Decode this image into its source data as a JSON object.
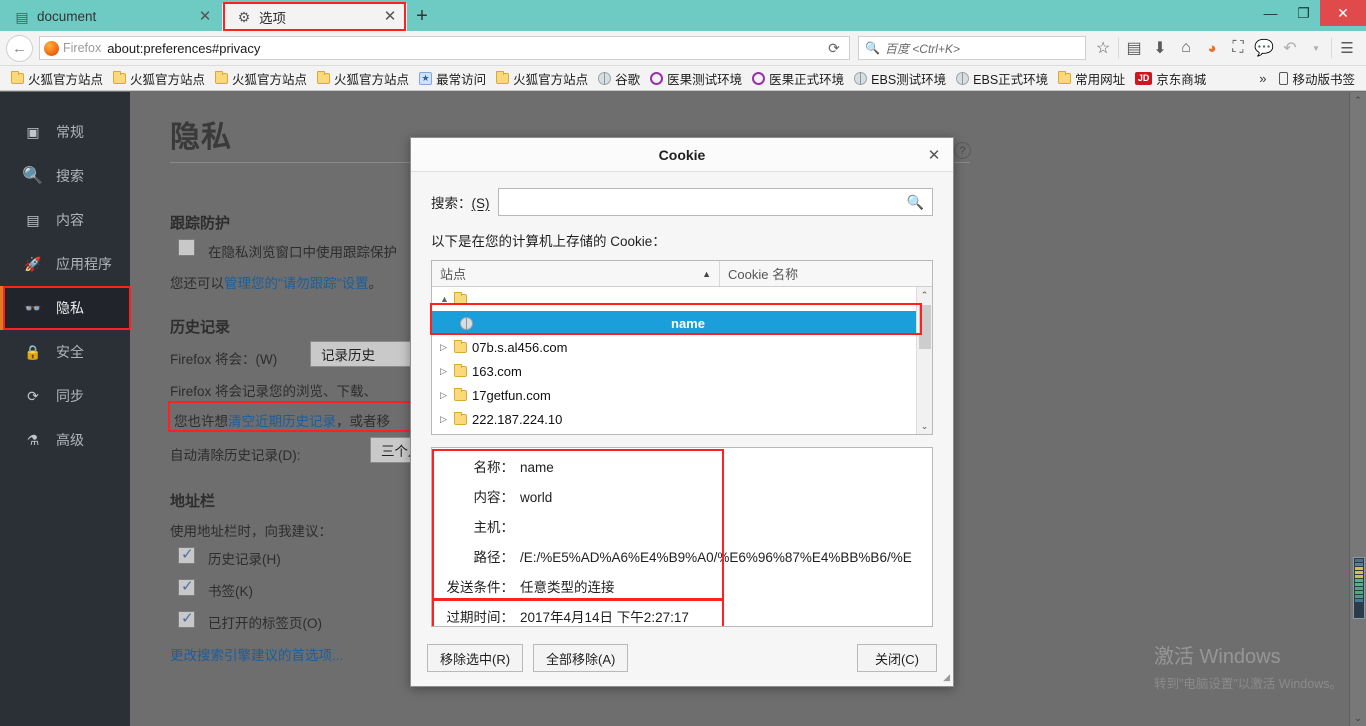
{
  "window": {
    "minimize_label": "—",
    "maximize_label": "❐",
    "close_label": "✕"
  },
  "tabs": [
    {
      "title": "document",
      "icon": "page-icon",
      "active": false,
      "close_label": "✕"
    },
    {
      "title": "选项",
      "icon": "gear-icon",
      "active": true,
      "close_label": "✕",
      "highlighted": true
    }
  ],
  "newtab_label": "+",
  "navbar": {
    "back_label": "←",
    "firefox_badge": "Firefox",
    "url": "about:preferences#privacy",
    "reload_label": "⟳",
    "search_placeholder": "百度 <Ctrl+K>",
    "search_value": "",
    "icons": [
      "star-icon",
      "reader-icon",
      "download-icon",
      "home-icon",
      "pocket-icon",
      "screenshot-icon",
      "chat-icon",
      "undo-icon",
      "chevron-down-icon",
      "hamburger-menu-icon"
    ]
  },
  "bookmarks": [
    {
      "label": "火狐官方站点",
      "icon": "folder-icon"
    },
    {
      "label": "火狐官方站点",
      "icon": "folder-icon"
    },
    {
      "label": "火狐官方站点",
      "icon": "folder-icon"
    },
    {
      "label": "火狐官方站点",
      "icon": "folder-icon"
    },
    {
      "label": "最常访问",
      "icon": "bluebox-icon"
    },
    {
      "label": "火狐官方站点",
      "icon": "folder-icon"
    },
    {
      "label": "谷歌",
      "icon": "globe-icon"
    },
    {
      "label": "医果测试环境",
      "icon": "ring-icon"
    },
    {
      "label": "医果正式环境",
      "icon": "ring-icon"
    },
    {
      "label": "EBS测试环境",
      "icon": "globe-icon"
    },
    {
      "label": "EBS正式环境",
      "icon": "globe-icon"
    },
    {
      "label": "常用网址",
      "icon": "folder-icon"
    },
    {
      "label": "京东商城",
      "icon": "jd-icon"
    }
  ],
  "bookmarks_overflow_label": "»",
  "bookmarks_mobile": {
    "label": "移动版书签",
    "icon": "phone-icon"
  },
  "sidebar": {
    "items": [
      {
        "label": "常规",
        "icon": "general-icon",
        "selected": false
      },
      {
        "label": "搜索",
        "icon": "search-icon",
        "selected": false
      },
      {
        "label": "内容",
        "icon": "content-icon",
        "selected": false
      },
      {
        "label": "应用程序",
        "icon": "applications-icon",
        "selected": false
      },
      {
        "label": "隐私",
        "icon": "mask-icon",
        "selected": true
      },
      {
        "label": "安全",
        "icon": "lock-icon",
        "selected": false
      },
      {
        "label": "同步",
        "icon": "sync-icon",
        "selected": false
      },
      {
        "label": "高级",
        "icon": "advanced-icon",
        "selected": false
      }
    ]
  },
  "preferences": {
    "title": "隐私",
    "help_label": "?",
    "tracking": {
      "heading": "跟踪防护",
      "checkbox_label": "在隐私浏览窗口中使用跟踪保护",
      "checkbox_checked": false,
      "note_prefix": "您还可以",
      "note_link": "管理您的\"请勿跟踪\"设置",
      "note_suffix": "。"
    },
    "history": {
      "heading": "历史记录",
      "will_label": "Firefox 将会：(W)",
      "will_value": "记录历史",
      "desc": "Firefox 将会记录您的浏览、下载、",
      "clear_prefix": "您也许想",
      "clear_link": "清空近期历史记录",
      "clear_suffix": "，或者移",
      "auto_label": "自动清除历史记录(D):",
      "auto_value": "三个月以前"
    },
    "addressbar": {
      "heading": "地址栏",
      "desc": "使用地址栏时，向我建议：",
      "options": [
        {
          "label": "历史记录(H)",
          "checked": true
        },
        {
          "label": "书签(K)",
          "checked": true
        },
        {
          "label": "已打开的标签页(O)",
          "checked": true
        }
      ],
      "change_link": "更改搜索引擎建议的首选项..."
    }
  },
  "dialog": {
    "title": "Cookie",
    "close_label": "✕",
    "search_label": "搜索：(S)",
    "search_value": "",
    "search_icon": "search-icon",
    "description": "以下是在您的计算机上存储的 Cookie：",
    "columns": {
      "site": "站点",
      "cookie_name": "Cookie 名称",
      "sort_arrow": "▲"
    },
    "rows": [
      {
        "label": "",
        "icon": "folder-icon",
        "twisty": "▲",
        "level": 0,
        "selected": false
      },
      {
        "label": "",
        "cookie_name": "name",
        "icon": "globe-icon",
        "level": 1,
        "selected": true
      },
      {
        "label": "07b.s.al456.com",
        "icon": "folder-icon",
        "twisty": "▷",
        "level": 0,
        "selected": false
      },
      {
        "label": "163.com",
        "icon": "folder-icon",
        "twisty": "▷",
        "level": 0,
        "selected": false
      },
      {
        "label": "17getfun.com",
        "icon": "folder-icon",
        "twisty": "▷",
        "level": 0,
        "selected": false
      },
      {
        "label": "222.187.224.10",
        "icon": "folder-icon",
        "twisty": "▷",
        "level": 0,
        "selected": false
      }
    ],
    "scroll_up": "⌃",
    "scroll_down": "⌄",
    "detail": [
      {
        "label": "名称：",
        "value": "name"
      },
      {
        "label": "内容：",
        "value": "world"
      },
      {
        "label": "主机：",
        "value": ""
      },
      {
        "label": "路径：",
        "value": "/E:/%E5%AD%A6%E4%B9%A0/%E6%96%87%E4%BB%B6/%E"
      },
      {
        "label": "发送条件：",
        "value": "任意类型的连接"
      },
      {
        "label": "过期时间：",
        "value": "2017年4月14日 下午2:27:17"
      }
    ],
    "buttons": {
      "remove_selected": "移除选中(R)",
      "remove_all": "全部移除(A)",
      "close": "关闭(C)"
    }
  },
  "watermark": {
    "line1": "激活 Windows",
    "line2": "转到\"电脑设置\"以激活 Windows。"
  }
}
